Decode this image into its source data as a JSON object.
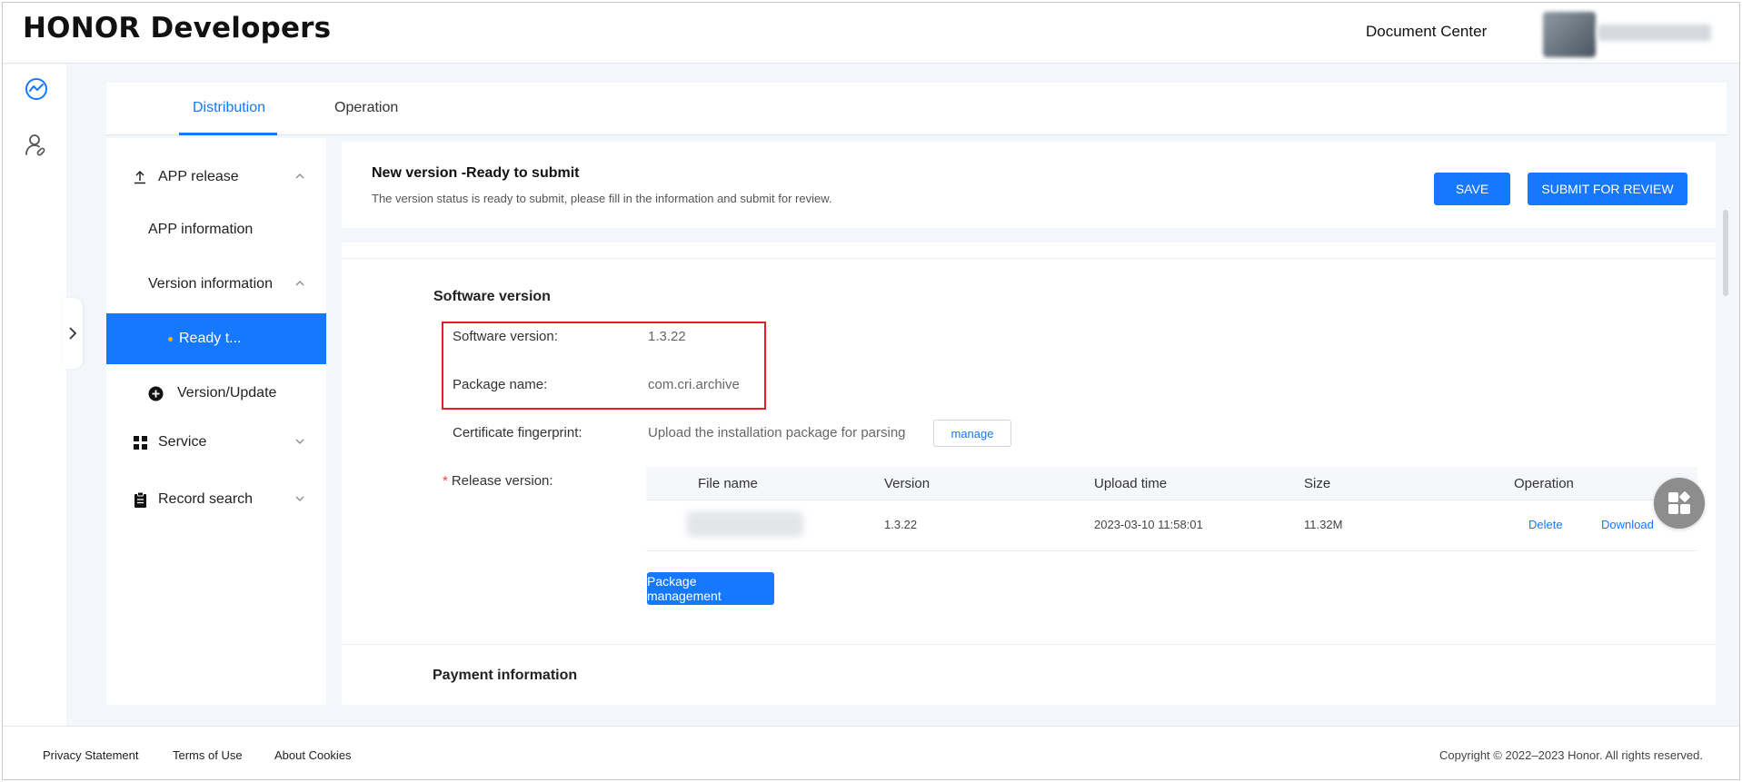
{
  "header": {
    "logo": "HONOR Developers",
    "document_center": "Document Center"
  },
  "rail": {
    "icons": [
      "analytics-icon",
      "user-link-icon"
    ]
  },
  "tabs": [
    {
      "label": "Distribution",
      "active": true
    },
    {
      "label": "Operation",
      "active": false
    }
  ],
  "sidemenu": {
    "items": [
      {
        "label": "APP release",
        "icon": "upload-icon",
        "chevron": "up"
      },
      {
        "label": "APP information"
      },
      {
        "label": "Version information",
        "chevron": "up"
      },
      {
        "label": "Ready t...",
        "active": true
      },
      {
        "label": "Version/Update",
        "icon": "plus-circle-icon"
      },
      {
        "label": "Service",
        "icon": "grid-icon",
        "chevron": "down"
      },
      {
        "label": "Record search",
        "icon": "clipboard-icon",
        "chevron": "down"
      }
    ]
  },
  "status": {
    "title": "New version -Ready to submit",
    "description": "The version status is ready to submit, please fill in the information and submit for review.",
    "save_label": "SAVE",
    "submit_label": "SUBMIT FOR REVIEW"
  },
  "software": {
    "section_title": "Software version",
    "version_label": "Software version:",
    "version_value": "1.3.22",
    "package_label": "Package name:",
    "package_value": "com.cri.archive",
    "cert_label": "Certificate fingerprint:",
    "cert_value": "Upload the installation package for parsing",
    "manage_label": "manage",
    "release_required_mark": "*",
    "release_label": "Release version:"
  },
  "release_table": {
    "columns": [
      "File name",
      "Version",
      "Upload time",
      "Size",
      "Operation"
    ],
    "rows": [
      {
        "version": "1.3.22",
        "upload_time": "2023-03-10 11:58:01",
        "size": "11.32M",
        "delete": "Delete",
        "download": "Download"
      }
    ],
    "package_management_label": "Package management"
  },
  "payment": {
    "section_title": "Payment information"
  },
  "footer": {
    "privacy": "Privacy Statement",
    "terms": "Terms of Use",
    "cookies": "About Cookies",
    "copyright": "Copyright © 2022–2023 Honor. All rights reserved."
  },
  "colors": {
    "accent": "#1677ff",
    "highlight": "#e02020"
  }
}
